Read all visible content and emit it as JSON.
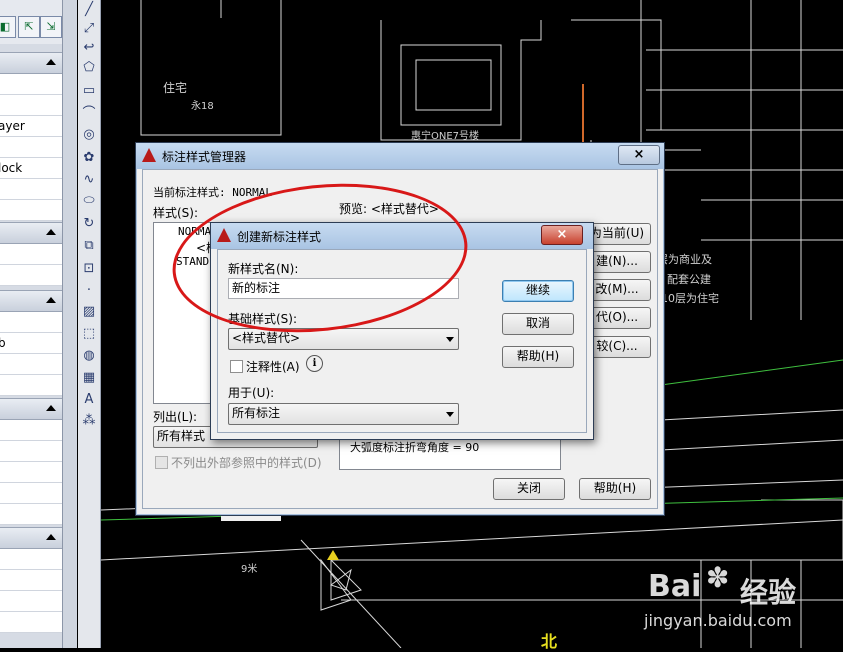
{
  "palette": {
    "rows": [
      "ayer",
      "lock",
      "b"
    ]
  },
  "canvas": {
    "labels": [
      "住宅",
      "永18",
      "惠宁ONE7号楼",
      "层为商业及",
      "配套公建",
      "-10层为住宅",
      "北",
      "9米"
    ]
  },
  "main_dialog": {
    "title": "标注样式管理器",
    "current_style_label": "当前标注样式: NORMAL",
    "styles_label": "样式(S):",
    "preview_label": "预览: <样式替代>",
    "list_items": [
      "NORMA",
      "<样",
      "STAND"
    ],
    "list_label": "列出(L):",
    "list_combo_value": "所有样式",
    "exclude_xref_label": "不列出外部参照中的样式(D)",
    "preview_text": "大弧度标注折弯角度 = 90",
    "side_buttons": [
      "为当前(U)",
      "建(N)...",
      "改(M)...",
      "代(O)...",
      "较(C)..."
    ],
    "close_button": "关闭",
    "help_button": "帮助(H)",
    "close_x": "×"
  },
  "create_dialog": {
    "title": "创建新标注样式",
    "close_x": "×",
    "new_name_label": "新样式名(N):",
    "new_name_value": "新的标注",
    "base_style_label": "基础样式(S):",
    "base_style_value": "<样式替代>",
    "annotative_label": "注释性(A)",
    "info_icon": "i",
    "use_for_label": "用于(U):",
    "use_for_value": "所有标注",
    "continue_button": "继续",
    "cancel_button": "取消",
    "help_button": "帮助(H)"
  },
  "watermark": {
    "brand": "Bai",
    "brand2": "经验",
    "url": "jingyan.baidu.com"
  },
  "colors": {
    "title_gradient": "#b3cbe8",
    "close_red": "#c8412e",
    "annotation_circle": "#d81818",
    "cad_line": "#e6e6e6"
  }
}
